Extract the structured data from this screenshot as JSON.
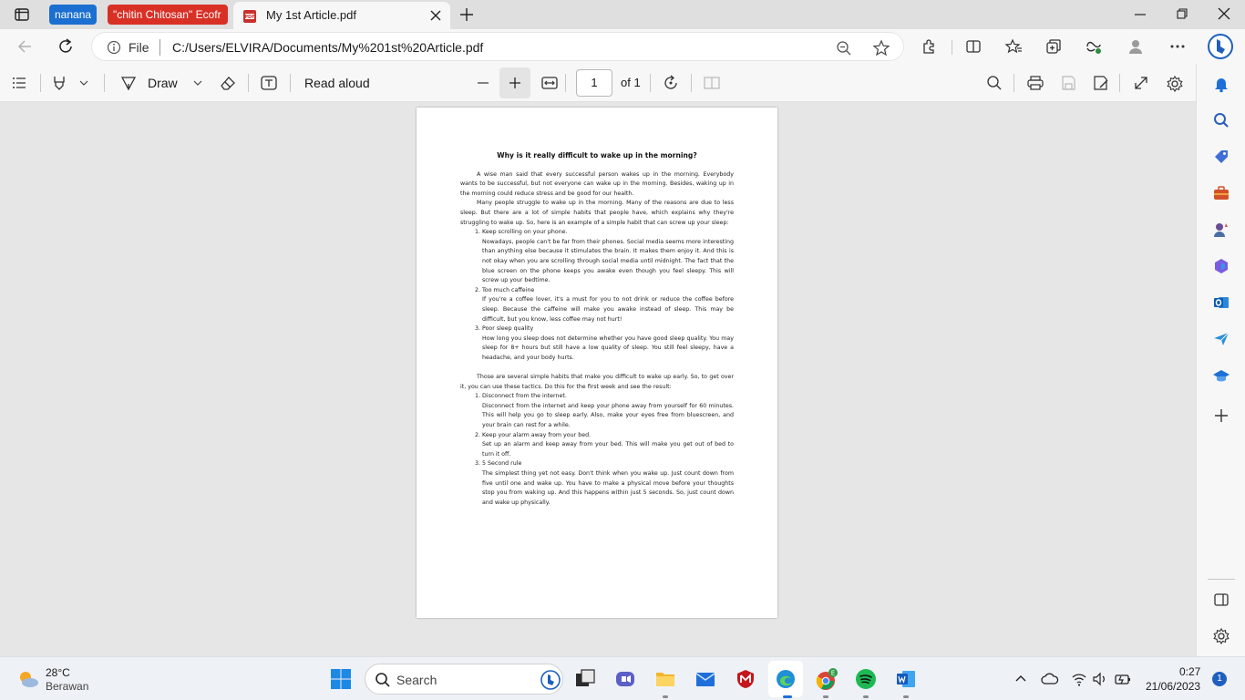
{
  "browser": {
    "tab_groups": [
      {
        "label": "nanana",
        "color": "#1a6fd0"
      },
      {
        "label": "\"chitin Chitosan\" Ecofr",
        "color": "#d93026"
      }
    ],
    "active_tab": {
      "title": "My 1st Article.pdf",
      "icon": "pdf-icon"
    },
    "address": {
      "scheme_label": "File",
      "url": "C:/Users/ELVIRA/Documents/My%201st%20Article.pdf"
    }
  },
  "pdf_toolbar": {
    "draw_label": "Draw",
    "read_aloud_label": "Read aloud",
    "page_number": "1",
    "page_total": "of 1"
  },
  "document": {
    "title": "Why is it really difficult to wake up in the morning?",
    "para1": "A wise man said that every successful person wakes up in the morning. Everybody wants to be successful, but not everyone can wake up in the morning. Besides, waking up in the morning could reduce stress and be good for our health.",
    "para2": "Many people struggle to wake up in the morning. Many of the reasons are due to less sleep. But there are a lot of simple habits that people have, which explains why they're struggling to wake up. So, here is an example of a simple habit that can screw up your sleep:",
    "habits": [
      {
        "heading": "Keep scrolling on your phone.",
        "body": "Nowadays, people can't be far from their phones. Social media seems more interesting than anything else because it stimulates the brain. It makes them enjoy it. And this is not okay when you are scrolling through social media until midnight. The fact that the blue screen on the phone keeps you awake even though you feel sleepy. This will screw up your bedtime."
      },
      {
        "heading": "Too much caffeine",
        "body": "If you're a coffee lover, it's a must for you to not drink or reduce the coffee before sleep. Because the caffeine will make you awake instead of sleep. This may be difficult, but you know, less coffee may not hurt!"
      },
      {
        "heading": "Poor sleep quality",
        "body": "How long you sleep does not determine whether you have good sleep quality. You may sleep for 8+ hours but still have a low quality of sleep. You still feel sleepy, have a headache, and your body hurts."
      }
    ],
    "para3": "Those are several simple habits that make you difficult to wake up early. So, to get over it, you can use these tactics. Do this for the first week and see the result:",
    "tactics": [
      {
        "heading": "Disconnect from the internet.",
        "body": "Disconnect from the internet and keep your phone away from yourself for 60 minutes. This will help you go to sleep early. Also, make your eyes free from bluescreen, and your brain can rest for a while."
      },
      {
        "heading": "Keep your alarm away from your bed.",
        "body": "Set up an alarm and keep away from your bed. This will make you get out of bed to turn it off."
      },
      {
        "heading": "5 Second rule",
        "body": "The simplest thing yet not easy. Don't think when you wake up. Just count down from five until one and wake up. You have to make a physical move before your thoughts stop you from waking up. And this happens within just 5 seconds. So, just count down and wake up physically."
      }
    ]
  },
  "taskbar": {
    "weather_temp": "28°C",
    "weather_cond": "Berawan",
    "search_label": "Search",
    "time": "0:27",
    "date": "21/06/2023",
    "notifications": "1"
  }
}
